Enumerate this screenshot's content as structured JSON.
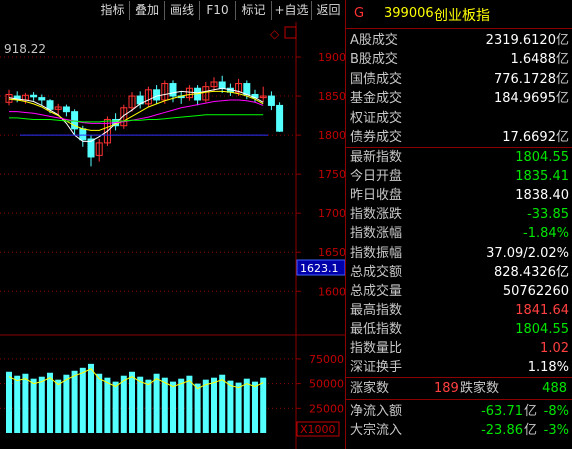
{
  "toolbar": {
    "buttons": [
      "指标",
      "叠加",
      "画线",
      "F10",
      "标记",
      "+自选",
      "返回"
    ]
  },
  "chart": {
    "hi_label": "918.22",
    "price_axis": [
      "1900",
      "1850",
      "1800",
      "1750",
      "1700",
      "1650",
      "1600"
    ],
    "current_price_tag": "1623.1",
    "volume_axis": [
      "75000",
      "50000",
      "25000"
    ],
    "volume_unit": "X1000",
    "colors": {
      "up": "#ff3232",
      "down": "#54ffff",
      "ma5": "#ffffff",
      "ma10": "#ffff00",
      "ma20": "#ff00ff",
      "ma60": "#00ff00",
      "grid": "#8b0000"
    }
  },
  "header": {
    "icon": "G",
    "code": "399006",
    "name": "创业板指"
  },
  "stats": [
    {
      "label": "A股成交",
      "value": "2319.6120",
      "unit": "亿",
      "color": "#ffffff"
    },
    {
      "label": "B股成交",
      "value": "1.6488",
      "unit": "亿",
      "color": "#ffffff"
    },
    {
      "label": "国债成交",
      "value": "776.1728",
      "unit": "亿",
      "color": "#ffffff"
    },
    {
      "label": "基金成交",
      "value": "184.9695",
      "unit": "亿",
      "color": "#ffffff"
    },
    {
      "label": "权证成交",
      "value": "",
      "unit": "",
      "color": "#ffffff"
    },
    {
      "label": "债券成交",
      "value": "17.6692",
      "unit": "亿",
      "color": "#ffffff"
    }
  ],
  "indices": [
    {
      "label": "最新指数",
      "value": "1804.55",
      "color": "#00e600"
    },
    {
      "label": "今日开盘",
      "value": "1835.41",
      "color": "#00e600"
    },
    {
      "label": "昨日收盘",
      "value": "1838.40",
      "color": "#ffffff"
    },
    {
      "label": "指数涨跌",
      "value": "-33.85",
      "color": "#00e600"
    },
    {
      "label": "指数涨幅",
      "value": "-1.84%",
      "color": "#00e600"
    },
    {
      "label": "指数振幅",
      "value": "37.09/2.02%",
      "color": "#ffffff"
    },
    {
      "label": "总成交额",
      "value": "828.4326亿",
      "color": "#ffffff"
    },
    {
      "label": "总成交量",
      "value": "50762260",
      "color": "#ffffff"
    },
    {
      "label": "最高指数",
      "value": "1841.64",
      "color": "#ff4040"
    },
    {
      "label": "最低指数",
      "value": "1804.55",
      "color": "#00e600"
    },
    {
      "label": "指数量比",
      "value": "1.02",
      "color": "#ff4040"
    },
    {
      "label": "深证换手",
      "value": "1.18%",
      "color": "#ffffff"
    }
  ],
  "breadth": {
    "up_label": "涨家数",
    "up_value": "189",
    "down_label": "跌家数",
    "down_value": "488"
  },
  "flows": [
    {
      "label": "净流入额",
      "value": "-63.71",
      "unit": "亿",
      "pct": "-8%"
    },
    {
      "label": "大宗流入",
      "value": "-23.86",
      "unit": "亿",
      "pct": "-3%"
    }
  ]
}
